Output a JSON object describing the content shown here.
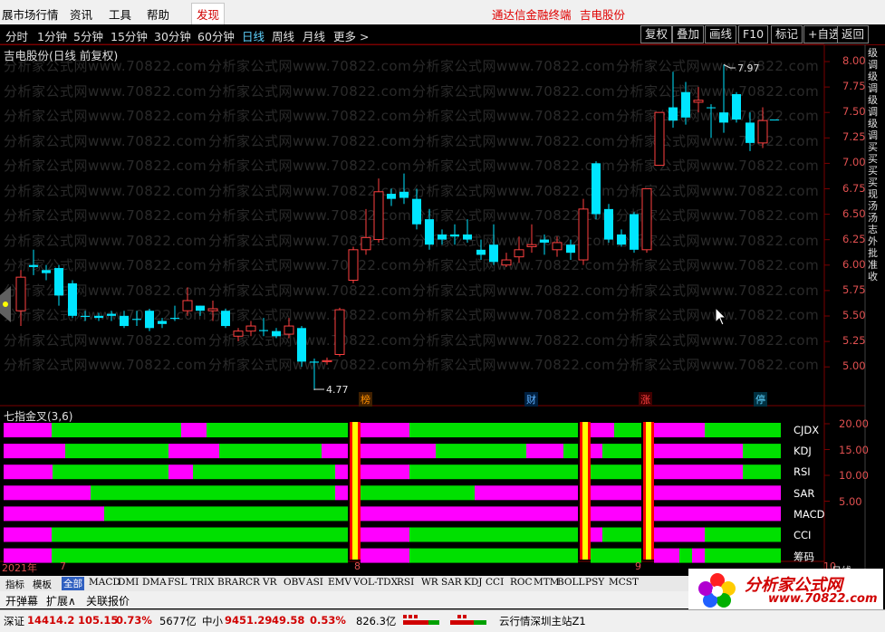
{
  "menu": {
    "items": [
      "展市场行情",
      "资讯",
      "工具",
      "帮助"
    ],
    "active": "发现",
    "title_left": "通达信金融终端",
    "title_right": "吉电股份"
  },
  "toolbar": {
    "periods": [
      "分时",
      "1分钟",
      "5分钟",
      "15分钟",
      "30分钟",
      "60分钟",
      "日线",
      "周线",
      "月线",
      "更多 >"
    ],
    "selected": "日线",
    "buttons": [
      "复权",
      "叠加",
      "画线",
      "F10",
      "标记",
      "+自选",
      "返回"
    ]
  },
  "stock_label": "吉电股份(日线 前复权)",
  "watermark": "分析家公式网www.70822.com",
  "price_axis": [
    "8.00",
    "7.75",
    "7.50",
    "7.25",
    "7.00",
    "6.75",
    "6.50",
    "6.25",
    "6.00",
    "5.75",
    "5.50",
    "5.25",
    "5.00"
  ],
  "annotations": {
    "high": "7.97",
    "low": "4.77"
  },
  "markers": [
    {
      "text": "榜",
      "color": "#ff9000"
    },
    {
      "text": "财",
      "color": "#5fb0ff"
    },
    {
      "text": "涨",
      "color": "#ff4040"
    },
    {
      "text": "停",
      "color": "#5fd3ff"
    }
  ],
  "indicator": {
    "title": "七指金叉(3,6)",
    "rows": [
      "CJDX",
      "KDJ",
      "RSI",
      "SAR",
      "MACD",
      "CCI",
      "筹码"
    ],
    "axis": [
      "20.00",
      "15.00",
      "10.00",
      "5.00"
    ]
  },
  "dates": [
    "2021年",
    "7",
    "8",
    "9",
    "10"
  ],
  "period_label": "日线",
  "side_text": "级调级调级调级调买买买买现汤汤志外批准收",
  "tabs": [
    "指标",
    "模板",
    "全部",
    "MACD",
    "DMI",
    "DMA",
    "FSL",
    "TRIX",
    "BRAR",
    "CR",
    "VR",
    "OBV",
    "ASI",
    "EMV",
    "VOL-TDX",
    "RSI",
    "WR",
    "SAR",
    "KDJ",
    "CCI",
    "ROC",
    "MTM",
    "BOLL",
    "PSY",
    "MCST"
  ],
  "tab_selected": "全部",
  "bottom_buttons": [
    "开弹幕",
    "扩展∧",
    "关联报价"
  ],
  "status": {
    "sz_label": "深证",
    "sz_value": "14414.2",
    "sz_change": "105.15",
    "sz_pct": "0.73%",
    "sz_amount": "5677亿",
    "zx_label": "中小",
    "zx_value": "9451.29",
    "zx_change": "49.58",
    "zx_pct": "0.53%",
    "zx_amount": "826.3亿",
    "server": "云行情深圳主站Z1"
  },
  "logo": {
    "text": "分析家公式网",
    "url": "www.70822.com"
  },
  "colors": {
    "up": "#ff4040",
    "down": "#00e5ff",
    "magenta": "#ff00ff",
    "green": "#00e000",
    "yellow": "#ffff00",
    "red": "#ff0000"
  }
}
